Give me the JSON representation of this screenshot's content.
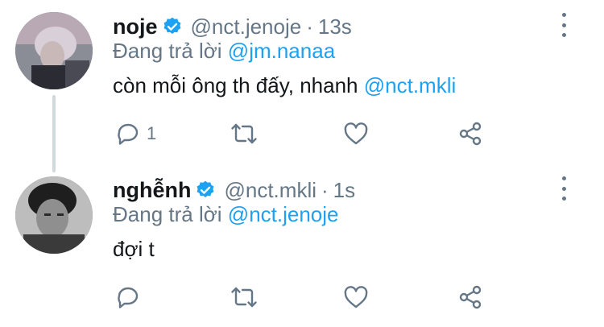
{
  "colors": {
    "accent": "#1da1f2",
    "muted": "#657786",
    "text": "#14171a",
    "thread_line": "#cfd9de"
  },
  "tweets": [
    {
      "name": "noje",
      "handle": "@nct.jenoje",
      "separator": "·",
      "time": "13s",
      "replying_prefix": "Đang trả lời",
      "replying_to": "@jm.nanaa",
      "text": "còn mỗi ông th đấy, nhanh",
      "text_mention": "@nct.mkli",
      "reply_count": "1",
      "icons": [
        "verified-badge-icon",
        "more-options-icon",
        "reply-icon",
        "retweet-icon",
        "like-icon",
        "share-icon"
      ]
    },
    {
      "name": "nghễnh",
      "handle": "@nct.mkli",
      "separator": "·",
      "time": "1s",
      "replying_prefix": "Đang trả lời",
      "replying_to": "@nct.jenoje",
      "text": "đợi t",
      "text_mention": "",
      "reply_count": "",
      "icons": [
        "verified-badge-icon",
        "more-options-icon",
        "reply-icon",
        "retweet-icon",
        "like-icon",
        "share-icon"
      ]
    }
  ]
}
